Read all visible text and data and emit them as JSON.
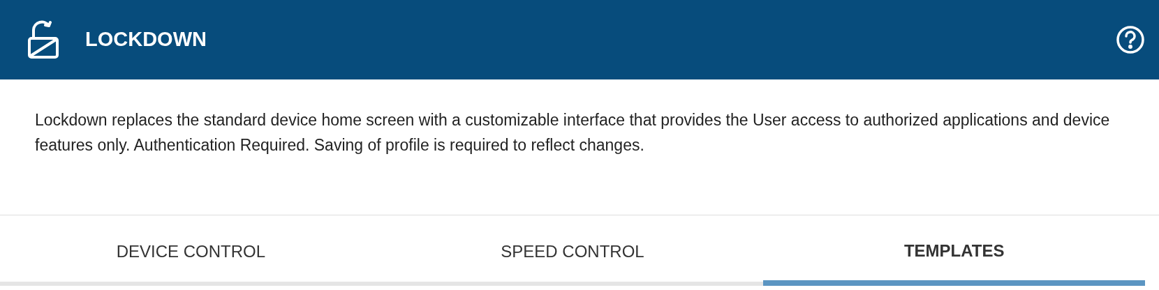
{
  "header": {
    "title": "LOCKDOWN"
  },
  "description": "Lockdown replaces the standard device home screen with a customizable interface that provides the User access to authorized applications and device features only. Authentication Required. Saving of profile is required to reflect changes.",
  "tabs": [
    {
      "label": "DEVICE CONTROL",
      "selected": false
    },
    {
      "label": "SPEED CONTROL",
      "selected": false
    },
    {
      "label": "TEMPLATES",
      "selected": true
    }
  ]
}
